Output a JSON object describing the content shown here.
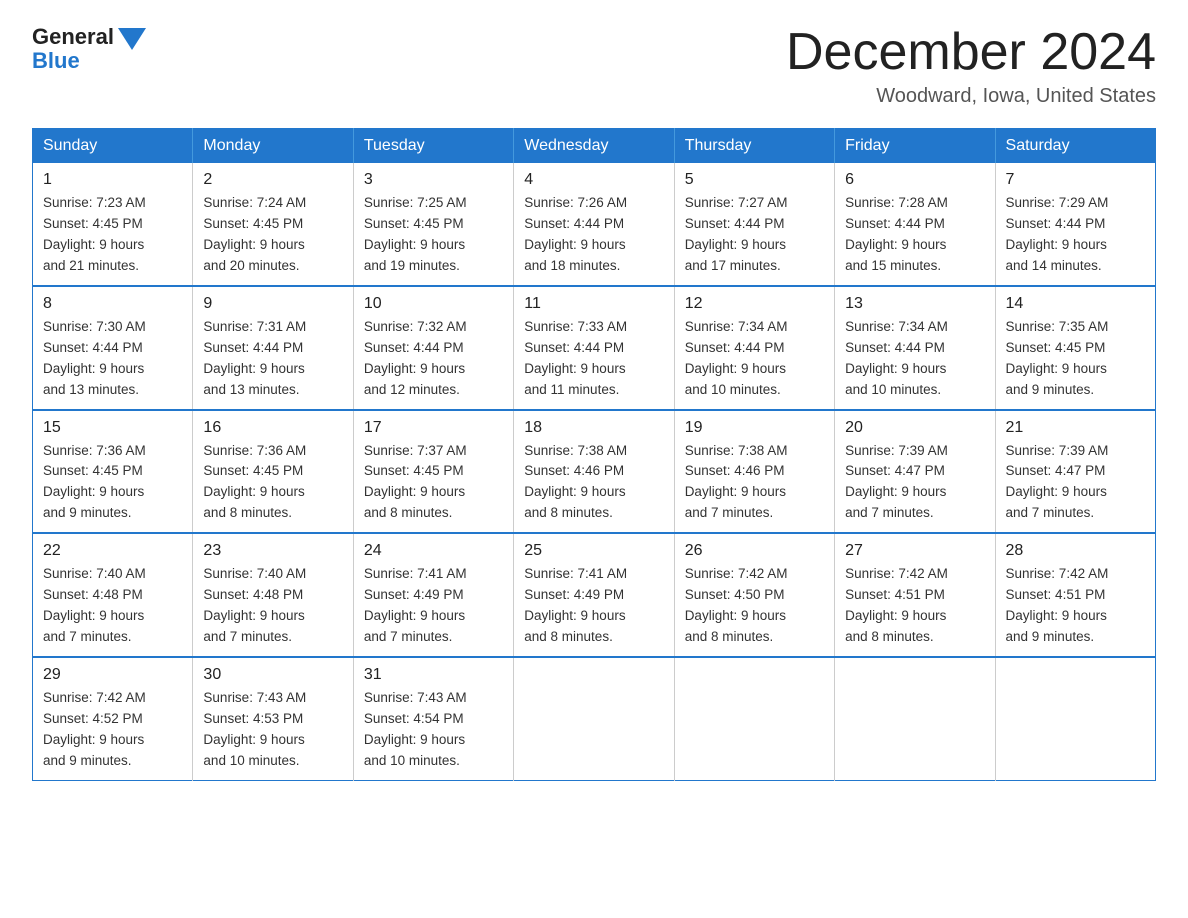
{
  "logo": {
    "general": "General",
    "blue": "Blue"
  },
  "title": "December 2024",
  "location": "Woodward, Iowa, United States",
  "days_of_week": [
    "Sunday",
    "Monday",
    "Tuesday",
    "Wednesday",
    "Thursday",
    "Friday",
    "Saturday"
  ],
  "weeks": [
    [
      {
        "day": "1",
        "sunrise": "7:23 AM",
        "sunset": "4:45 PM",
        "daylight": "9 hours and 21 minutes."
      },
      {
        "day": "2",
        "sunrise": "7:24 AM",
        "sunset": "4:45 PM",
        "daylight": "9 hours and 20 minutes."
      },
      {
        "day": "3",
        "sunrise": "7:25 AM",
        "sunset": "4:45 PM",
        "daylight": "9 hours and 19 minutes."
      },
      {
        "day": "4",
        "sunrise": "7:26 AM",
        "sunset": "4:44 PM",
        "daylight": "9 hours and 18 minutes."
      },
      {
        "day": "5",
        "sunrise": "7:27 AM",
        "sunset": "4:44 PM",
        "daylight": "9 hours and 17 minutes."
      },
      {
        "day": "6",
        "sunrise": "7:28 AM",
        "sunset": "4:44 PM",
        "daylight": "9 hours and 15 minutes."
      },
      {
        "day": "7",
        "sunrise": "7:29 AM",
        "sunset": "4:44 PM",
        "daylight": "9 hours and 14 minutes."
      }
    ],
    [
      {
        "day": "8",
        "sunrise": "7:30 AM",
        "sunset": "4:44 PM",
        "daylight": "9 hours and 13 minutes."
      },
      {
        "day": "9",
        "sunrise": "7:31 AM",
        "sunset": "4:44 PM",
        "daylight": "9 hours and 13 minutes."
      },
      {
        "day": "10",
        "sunrise": "7:32 AM",
        "sunset": "4:44 PM",
        "daylight": "9 hours and 12 minutes."
      },
      {
        "day": "11",
        "sunrise": "7:33 AM",
        "sunset": "4:44 PM",
        "daylight": "9 hours and 11 minutes."
      },
      {
        "day": "12",
        "sunrise": "7:34 AM",
        "sunset": "4:44 PM",
        "daylight": "9 hours and 10 minutes."
      },
      {
        "day": "13",
        "sunrise": "7:34 AM",
        "sunset": "4:44 PM",
        "daylight": "9 hours and 10 minutes."
      },
      {
        "day": "14",
        "sunrise": "7:35 AM",
        "sunset": "4:45 PM",
        "daylight": "9 hours and 9 minutes."
      }
    ],
    [
      {
        "day": "15",
        "sunrise": "7:36 AM",
        "sunset": "4:45 PM",
        "daylight": "9 hours and 9 minutes."
      },
      {
        "day": "16",
        "sunrise": "7:36 AM",
        "sunset": "4:45 PM",
        "daylight": "9 hours and 8 minutes."
      },
      {
        "day": "17",
        "sunrise": "7:37 AM",
        "sunset": "4:45 PM",
        "daylight": "9 hours and 8 minutes."
      },
      {
        "day": "18",
        "sunrise": "7:38 AM",
        "sunset": "4:46 PM",
        "daylight": "9 hours and 8 minutes."
      },
      {
        "day": "19",
        "sunrise": "7:38 AM",
        "sunset": "4:46 PM",
        "daylight": "9 hours and 7 minutes."
      },
      {
        "day": "20",
        "sunrise": "7:39 AM",
        "sunset": "4:47 PM",
        "daylight": "9 hours and 7 minutes."
      },
      {
        "day": "21",
        "sunrise": "7:39 AM",
        "sunset": "4:47 PM",
        "daylight": "9 hours and 7 minutes."
      }
    ],
    [
      {
        "day": "22",
        "sunrise": "7:40 AM",
        "sunset": "4:48 PM",
        "daylight": "9 hours and 7 minutes."
      },
      {
        "day": "23",
        "sunrise": "7:40 AM",
        "sunset": "4:48 PM",
        "daylight": "9 hours and 7 minutes."
      },
      {
        "day": "24",
        "sunrise": "7:41 AM",
        "sunset": "4:49 PM",
        "daylight": "9 hours and 7 minutes."
      },
      {
        "day": "25",
        "sunrise": "7:41 AM",
        "sunset": "4:49 PM",
        "daylight": "9 hours and 8 minutes."
      },
      {
        "day": "26",
        "sunrise": "7:42 AM",
        "sunset": "4:50 PM",
        "daylight": "9 hours and 8 minutes."
      },
      {
        "day": "27",
        "sunrise": "7:42 AM",
        "sunset": "4:51 PM",
        "daylight": "9 hours and 8 minutes."
      },
      {
        "day": "28",
        "sunrise": "7:42 AM",
        "sunset": "4:51 PM",
        "daylight": "9 hours and 9 minutes."
      }
    ],
    [
      {
        "day": "29",
        "sunrise": "7:42 AM",
        "sunset": "4:52 PM",
        "daylight": "9 hours and 9 minutes."
      },
      {
        "day": "30",
        "sunrise": "7:43 AM",
        "sunset": "4:53 PM",
        "daylight": "9 hours and 10 minutes."
      },
      {
        "day": "31",
        "sunrise": "7:43 AM",
        "sunset": "4:54 PM",
        "daylight": "9 hours and 10 minutes."
      },
      null,
      null,
      null,
      null
    ]
  ]
}
